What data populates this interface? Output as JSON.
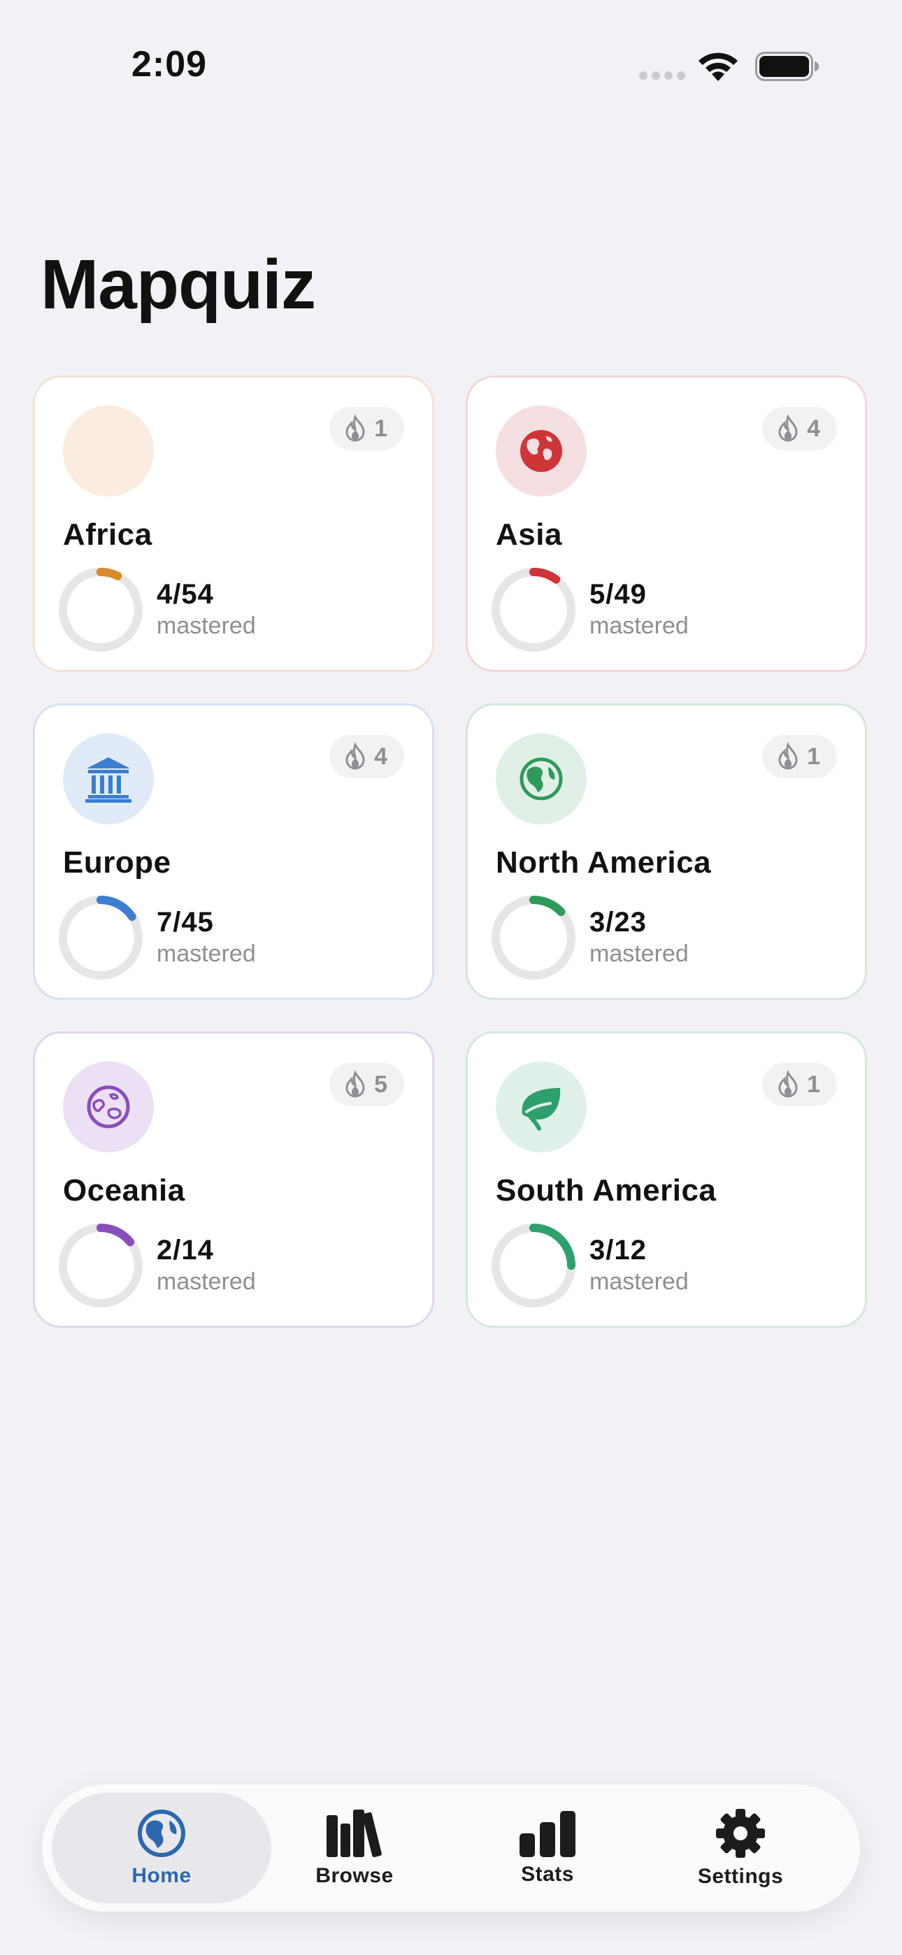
{
  "status_bar": {
    "time": "2:09"
  },
  "app": {
    "title": "Mapquiz"
  },
  "regions": [
    {
      "name": "Africa",
      "streak": "1",
      "count": "4/54",
      "mastered_label": "mastered",
      "progress": 0.074,
      "accent": "#d98a2b",
      "tint": "#fbece0",
      "border": "#f4e2d3",
      "icon": "none"
    },
    {
      "name": "Asia",
      "streak": "4",
      "count": "5/49",
      "mastered_label": "mastered",
      "progress": 0.102,
      "accent": "#cf3438",
      "tint": "#f6dfe0",
      "border": "#f2d6d8",
      "icon": "globe-asia-icon"
    },
    {
      "name": "Europe",
      "streak": "4",
      "count": "7/45",
      "mastered_label": "mastered",
      "progress": 0.156,
      "accent": "#3c7ed2",
      "tint": "#e1ebf7",
      "border": "#d6e2f1",
      "icon": "building-columns-icon"
    },
    {
      "name": "North America",
      "streak": "1",
      "count": "3/23",
      "mastered_label": "mastered",
      "progress": 0.13,
      "accent": "#2e9a5c",
      "tint": "#e0f0e6",
      "border": "#d3e8dc",
      "icon": "globe-americas-icon"
    },
    {
      "name": "Oceania",
      "streak": "5",
      "count": "2/14",
      "mastered_label": "mastered",
      "progress": 0.143,
      "accent": "#8a4dbd",
      "tint": "#ece0f4",
      "border": "#e1d6ed",
      "icon": "earth-oceania-icon"
    },
    {
      "name": "South America",
      "streak": "1",
      "count": "3/12",
      "mastered_label": "mastered",
      "progress": 0.25,
      "accent": "#2ea06e",
      "tint": "#dff1e9",
      "border": "#d2e9de",
      "icon": "leaf-icon"
    }
  ],
  "tabs": [
    {
      "label": "Home",
      "icon": "globe-americas-icon",
      "active": true
    },
    {
      "label": "Browse",
      "icon": "books-icon",
      "active": false
    },
    {
      "label": "Stats",
      "icon": "bar-chart-icon",
      "active": false
    },
    {
      "label": "Settings",
      "icon": "gear-icon",
      "active": false
    }
  ]
}
